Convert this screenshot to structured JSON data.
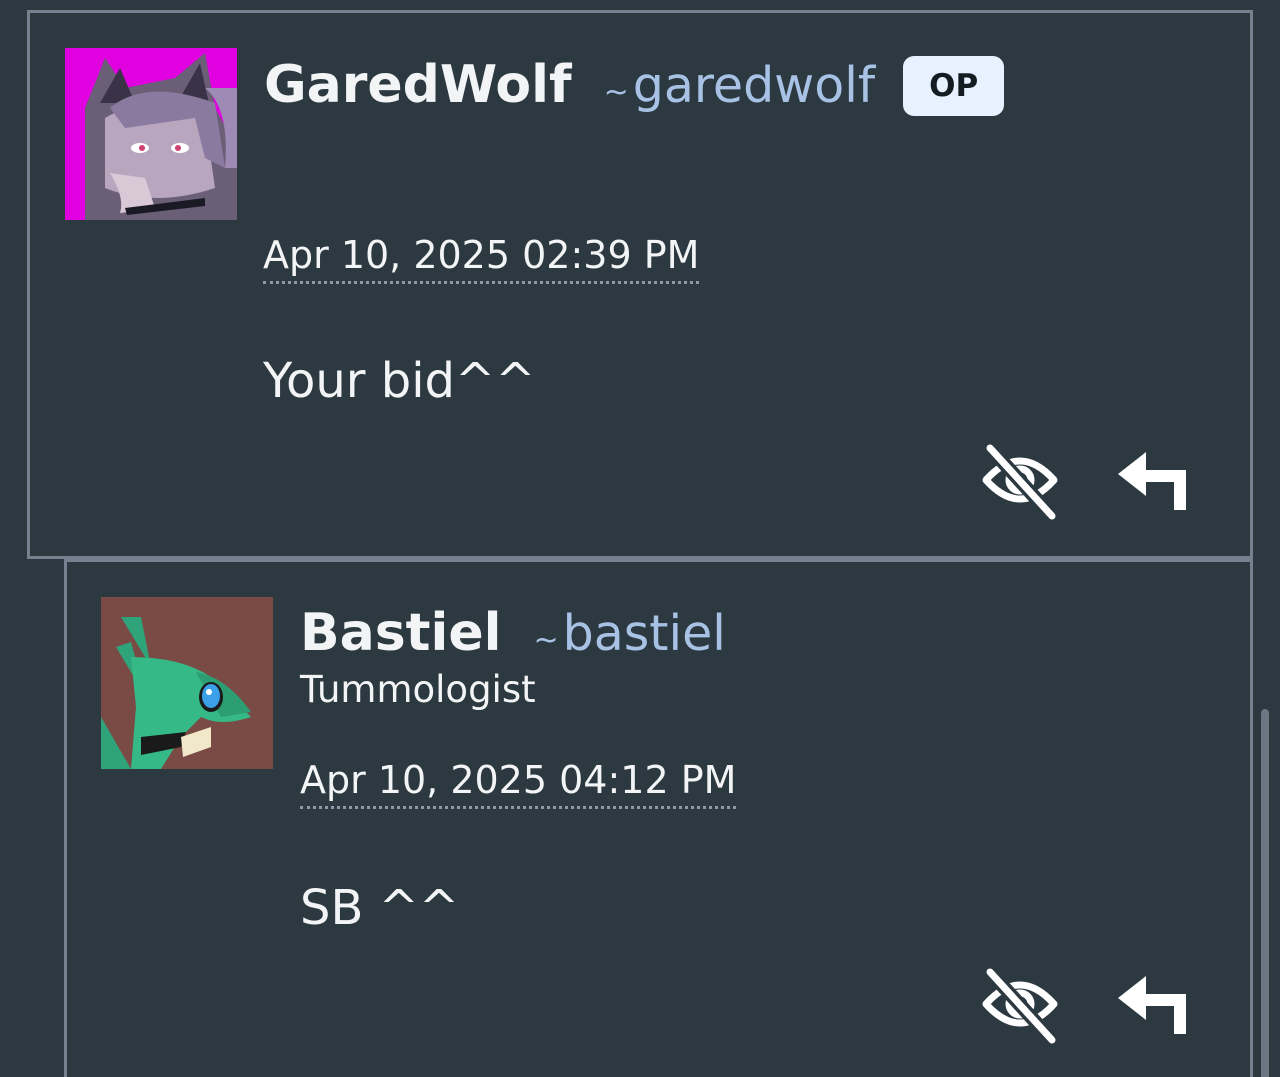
{
  "colors": {
    "background": "#2d3940",
    "border": "#76808f",
    "username": "#a8c2e6",
    "badge_bg": "#e7f1ff",
    "text": "#f2f4f5"
  },
  "comments": [
    {
      "display_name": "GaredWolf",
      "tilde": "~",
      "username": "garedwolf",
      "badge": "OP",
      "timestamp": "Apr 10, 2025 02:39 PM",
      "body": "Your bid^^",
      "avatar": "wolf-avatar",
      "actions": [
        "hide-icon",
        "reply-icon"
      ]
    },
    {
      "display_name": "Bastiel",
      "tilde": "~",
      "username": "bastiel",
      "user_title": "Tummologist",
      "timestamp": "Apr 10, 2025 04:12 PM",
      "body": "SB ^^",
      "avatar": "dragon-avatar",
      "actions": [
        "hide-icon",
        "reply-icon"
      ]
    }
  ]
}
